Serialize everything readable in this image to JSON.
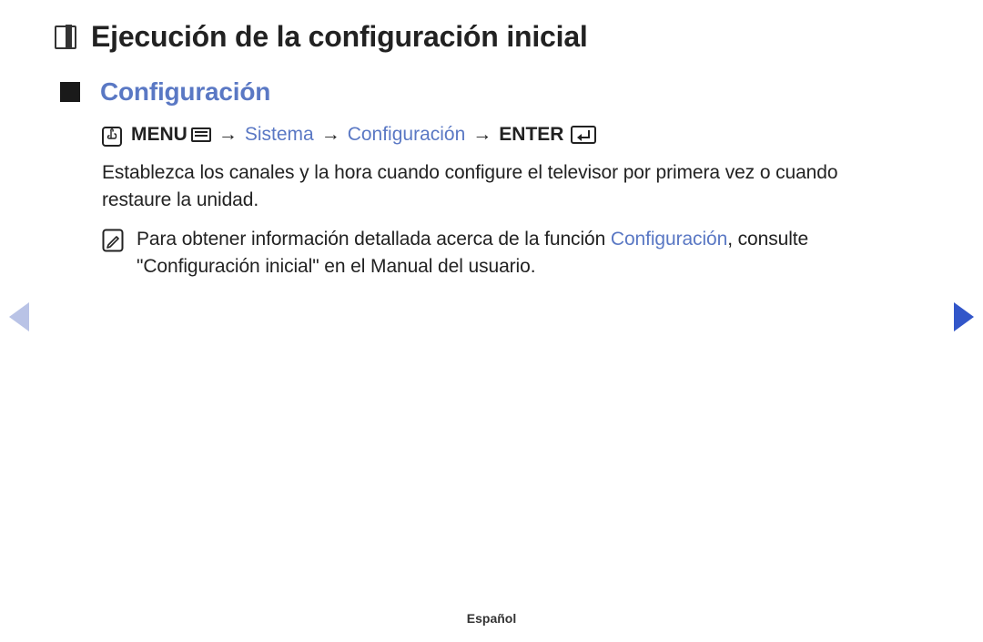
{
  "page": {
    "title": "Ejecución de la configuración inicial"
  },
  "section": {
    "title": "Configuración"
  },
  "breadcrumb": {
    "menu": "MENU",
    "arrow1": "→",
    "sistema": "Sistema",
    "arrow2": "→",
    "config": "Configuración",
    "arrow3": "→",
    "enter": "ENTER"
  },
  "body": {
    "paragraph": "Establezca los canales y la hora cuando configure el televisor por primera vez o cuando restaure la unidad."
  },
  "note": {
    "prefix": "Para obtener información detallada acerca de la función ",
    "highlight": "Configuración",
    "suffix": ", consulte \"Configuración inicial\" en el Manual del usuario."
  },
  "footer": {
    "language": "Español"
  }
}
